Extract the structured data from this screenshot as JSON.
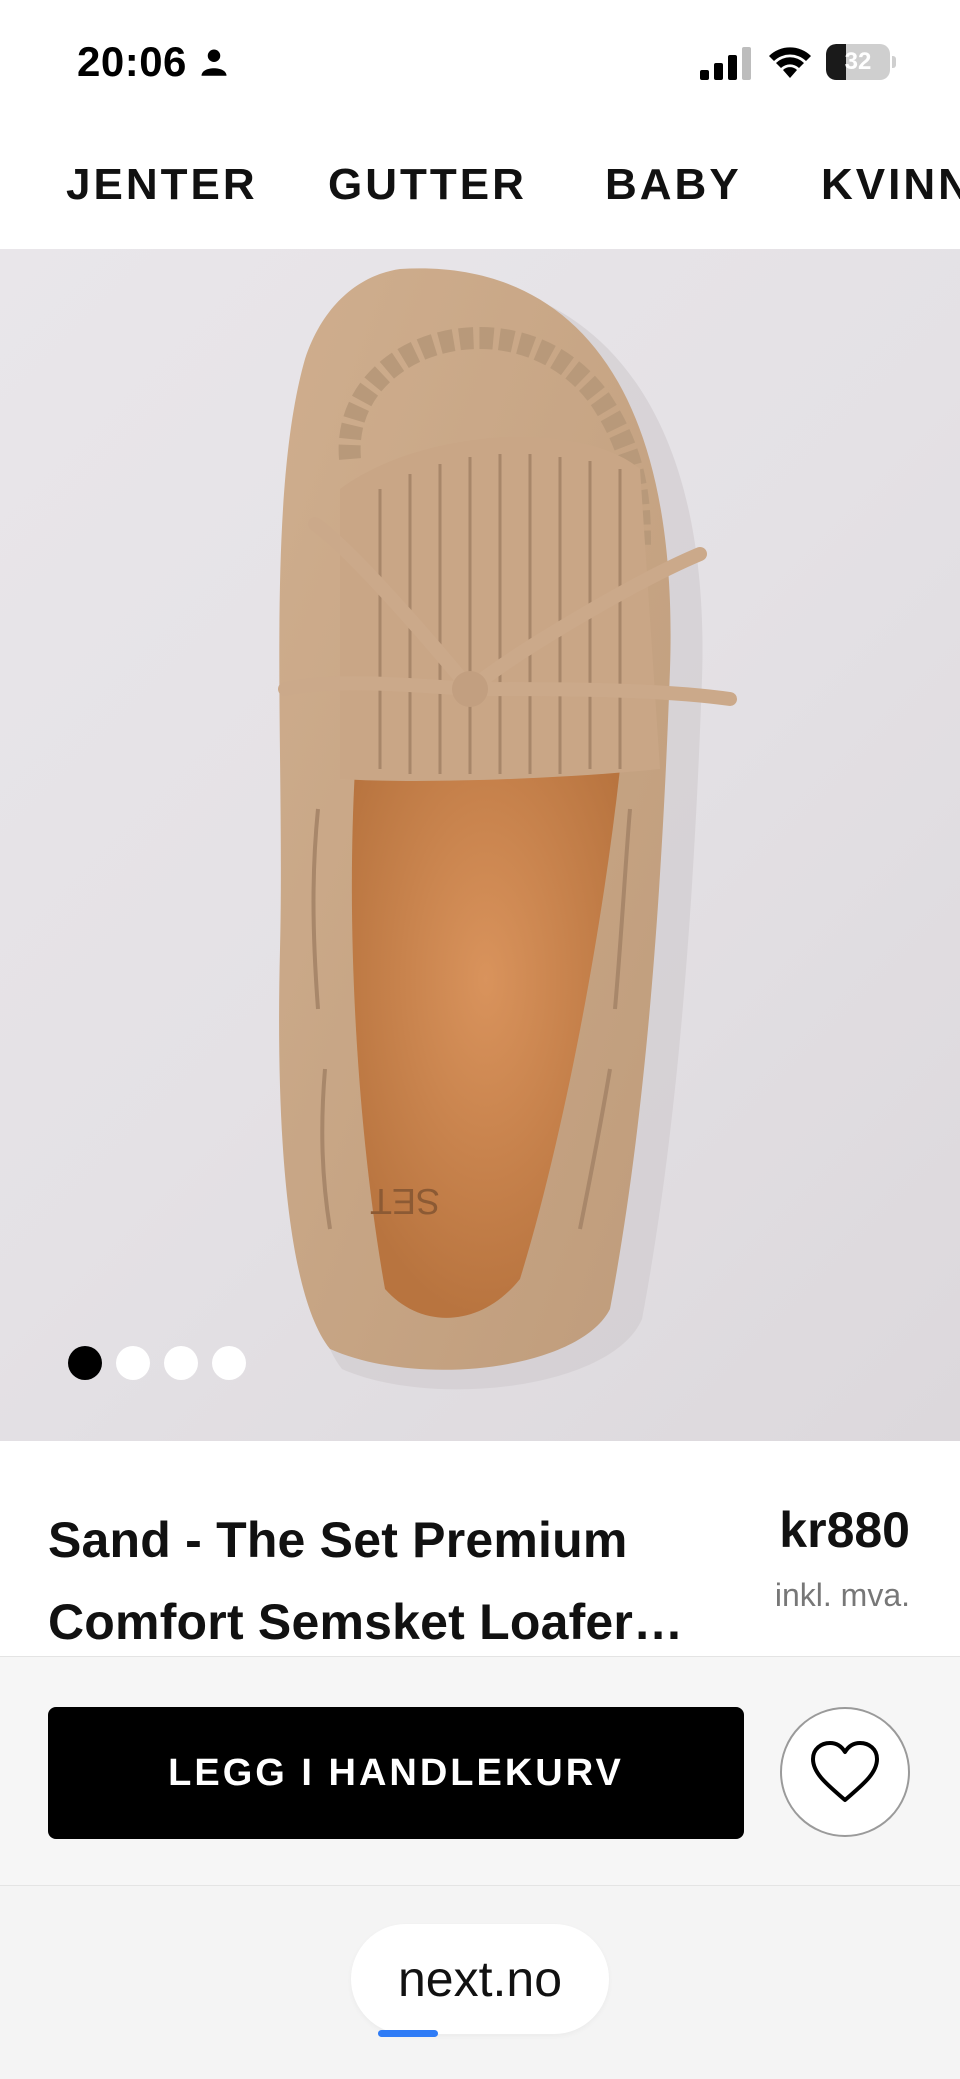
{
  "status_bar": {
    "time": "20:06",
    "battery_level": "32",
    "battery_fraction": 0.32
  },
  "nav": {
    "items": [
      "JENTER",
      "GUTTER",
      "BABY",
      "KVINNER"
    ]
  },
  "product": {
    "title": "Sand - The Set Premium Comfort Semsket Loafer…",
    "price": "kr880",
    "vat_note": "inkl. mva.",
    "carousel": {
      "total": 4,
      "active_index": 0
    }
  },
  "actions": {
    "add_to_cart_label": "LEGG I HANDLEKURV"
  },
  "browser": {
    "url": "next.no"
  },
  "colors": {
    "primary_button": "#000000",
    "page_background": "#ffffff",
    "loading_bar": "#2f7cf6"
  },
  "icons": {
    "person": "person-icon",
    "signal": "signal-icon",
    "wifi": "wifi-icon",
    "battery": "battery-icon",
    "wishlist": "heart-icon"
  }
}
